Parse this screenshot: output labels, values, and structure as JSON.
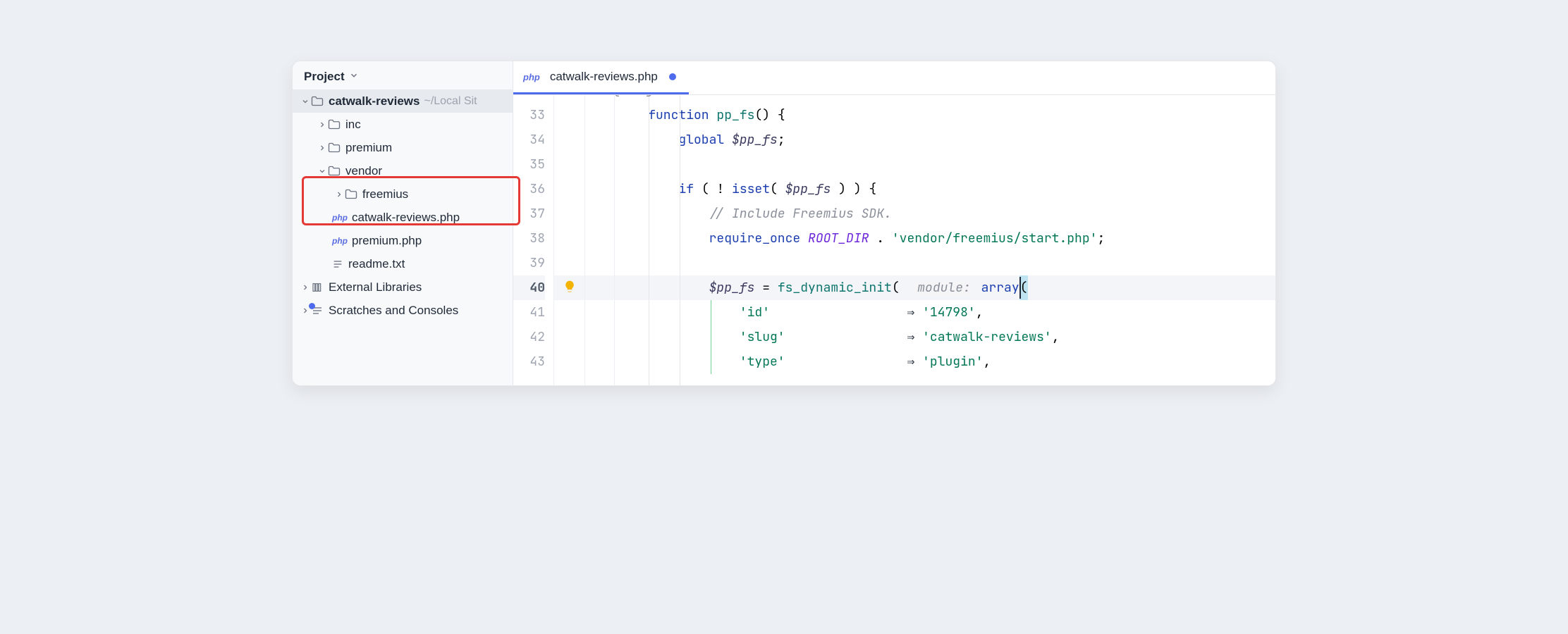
{
  "sidebar": {
    "title": "Project",
    "root": {
      "name": "catwalk-reviews",
      "path": "~/Local Sit"
    },
    "items": {
      "inc": "inc",
      "premium": "premium",
      "vendor": "vendor",
      "freemius": "freemius",
      "file_main": "catwalk-reviews.php",
      "file_premium": "premium.php",
      "file_readme": "readme.txt",
      "external": "External Libraries",
      "scratches": "Scratches and Consoles"
    }
  },
  "tab": {
    "badge": "php",
    "name": "catwalk-reviews.php"
  },
  "gutter": [
    "33",
    "34",
    "35",
    "36",
    "37",
    "38",
    "39",
    "40",
    "41",
    "42",
    "43"
  ],
  "code": {
    "partial_top": "@usage",
    "kw_function": "function",
    "kw_global": "global",
    "kw_if": "if",
    "kw_isset": "isset",
    "kw_require": "require_once",
    "kw_array": "array",
    "fn_name": "pp_fs",
    "var_ppfs": "$pp_fs",
    "comment_sdk": "// Include Freemius SDK.",
    "rootdir": "ROOT_DIR",
    "str_path": "'vendor/freemius/start.php'",
    "fs_init": "fs_dynamic_init",
    "module_hint": "module:",
    "id_key": "'id'",
    "id_val": "'14798'",
    "slug_key": "'slug'",
    "slug_val": "'catwalk-reviews'",
    "type_key": "'type'",
    "type_val": "'plugin'",
    "arrow": "⇒",
    "dot": " . "
  }
}
